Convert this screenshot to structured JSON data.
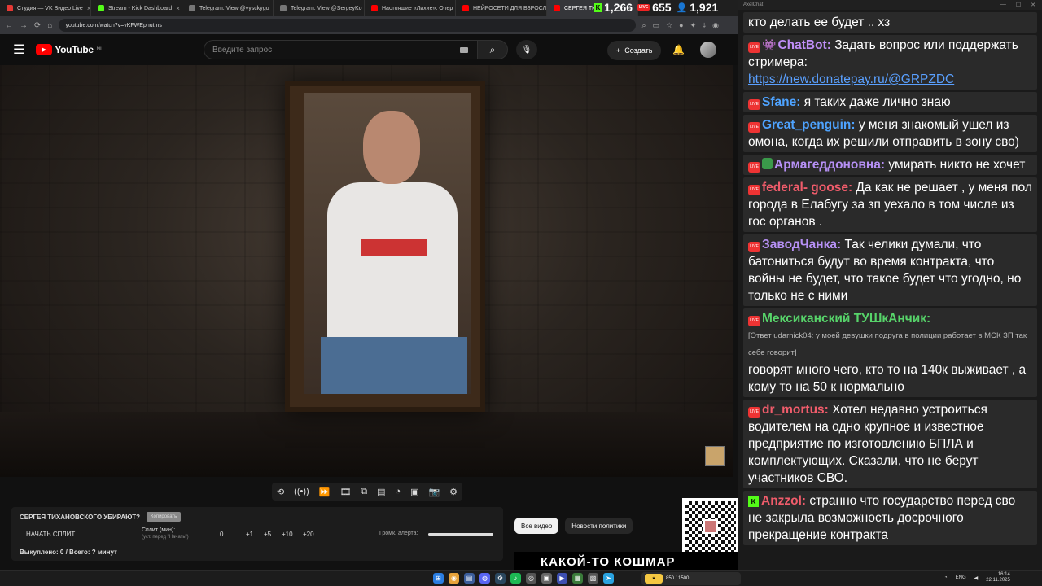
{
  "browser": {
    "tabs": [
      {
        "title": "Студия — VK Видео Live",
        "favicon_color": "#e53935"
      },
      {
        "title": "Stream - Kick Dashboard",
        "favicon_color": "#53fc18"
      },
      {
        "title": "Telegram: View @vysckygo",
        "favicon_color": "#777777"
      },
      {
        "title": "Telegram: View @SergeyKo",
        "favicon_color": "#777777"
      },
      {
        "title": "Настоящие «Лихие». Опер",
        "favicon_color": "#ff0000"
      },
      {
        "title": "НЕЙРОСЕТИ ДЛЯ ВЗРОСЛ",
        "favicon_color": "#ff0000"
      },
      {
        "title": "СЕРГЕЯ ТИ",
        "favicon_color": "#ff0000",
        "active": true
      }
    ],
    "url": "youtube.com/watch?v=vKFWEpnutms"
  },
  "stream_stats": {
    "kick": "1,266",
    "vk": "655",
    "viewers": "1,921"
  },
  "youtube": {
    "logo_text": "YouTube",
    "region": "NL",
    "search_placeholder": "Введите запрос",
    "create_label": "Создать"
  },
  "toolbar_icons": [
    "repeat-icon",
    "broadcast-icon",
    "speed-icon",
    "film-icon",
    "picture-in-picture-icon",
    "subtitles-icon",
    "gauge-icon",
    "screen-icon",
    "camera-icon",
    "settings-icon"
  ],
  "split_panel": {
    "title": "СЕРГЕЯ ТИХАНОВСКОГО УБИРАЮТ?",
    "tag": "Копировать",
    "start_label": "НАЧАТЬ СПЛИТ",
    "split_label": "Сплит (мин):",
    "split_hint": "(уст. перед \"Начать\")",
    "split_value": "0",
    "increments": [
      "+1",
      "+5",
      "+10",
      "+20"
    ],
    "volume_label": "Громк. алерта:",
    "volume_level": 1.0,
    "bought": "Выкуплено: 0 / Всего: ? минут"
  },
  "chips": {
    "all": "Все видео",
    "politics": "Новости политики"
  },
  "thumbnail_text": "КАКОЙ-ТО КОШМАР",
  "chat": {
    "window_title": "AxelChat",
    "messages": [
      {
        "platform": "",
        "name": "",
        "name_color": "#ffffff",
        "text": "кто делать ее будет .. хз"
      },
      {
        "platform": "vk",
        "bot": true,
        "name": "ChatBot:",
        "name_color": "#c08ef7",
        "text": "Задать вопрос или поддержать стримера:",
        "link": "https://new.donatepay.ru/@GRPZDC"
      },
      {
        "platform": "vk",
        "name": "Sfane:",
        "name_color": "#4ea3ff",
        "text": "я таких даже лично знаю"
      },
      {
        "platform": "vk",
        "name": "Great_penguin:",
        "name_color": "#4ea3ff",
        "text": "у меня знакомый ушел из омона, когда их решили отправить в зону сво)"
      },
      {
        "platform": "vk",
        "shield": true,
        "name": "Армагеддоновна:",
        "name_color": "#b690f5",
        "text": "умирать никто не хочет"
      },
      {
        "platform": "vk",
        "name": "federal- goose:",
        "name_color": "#f05c6b",
        "text": "Да как не решает , у меня пол города в Елабугу за зп уехало в том числе из гос органов ."
      },
      {
        "platform": "vk",
        "name": "ЗаводЧанка:",
        "name_color": "#b690f5",
        "text": "Так челики думали, что батониться будут во время контракта, что войны не будет, что такое будет что угодно, но только не с ними"
      },
      {
        "platform": "vk",
        "name": "Мексиканский ТУШкАнчик:",
        "name_color": "#57d46a",
        "reply": "[Ответ udarnick04: у моей девушки подруга в полиции работает в МСК ЗП так себе говорит]",
        "text": "говорят много чего, кто то на 140к выживает , а кому то на 50 к нормально"
      },
      {
        "platform": "vk",
        "name": "dr_mortus:",
        "name_color": "#f05c6b",
        "text": "Хотел недавно устроиться водителем на одно крупное и известное предприятие по изготовлению БПЛА и комплектующих. Сказали, что не берут участников СВО."
      },
      {
        "platform": "kick",
        "name": "Anzzol:",
        "name_color": "#f05c6b",
        "text": "странно что государство перед сво не закрыла возможность досрочного прекращение контракта"
      }
    ]
  },
  "taskbar": {
    "widget_label": "850 / 1500",
    "lang": "ENG",
    "time": "16:14",
    "date": "22.11.2025"
  }
}
